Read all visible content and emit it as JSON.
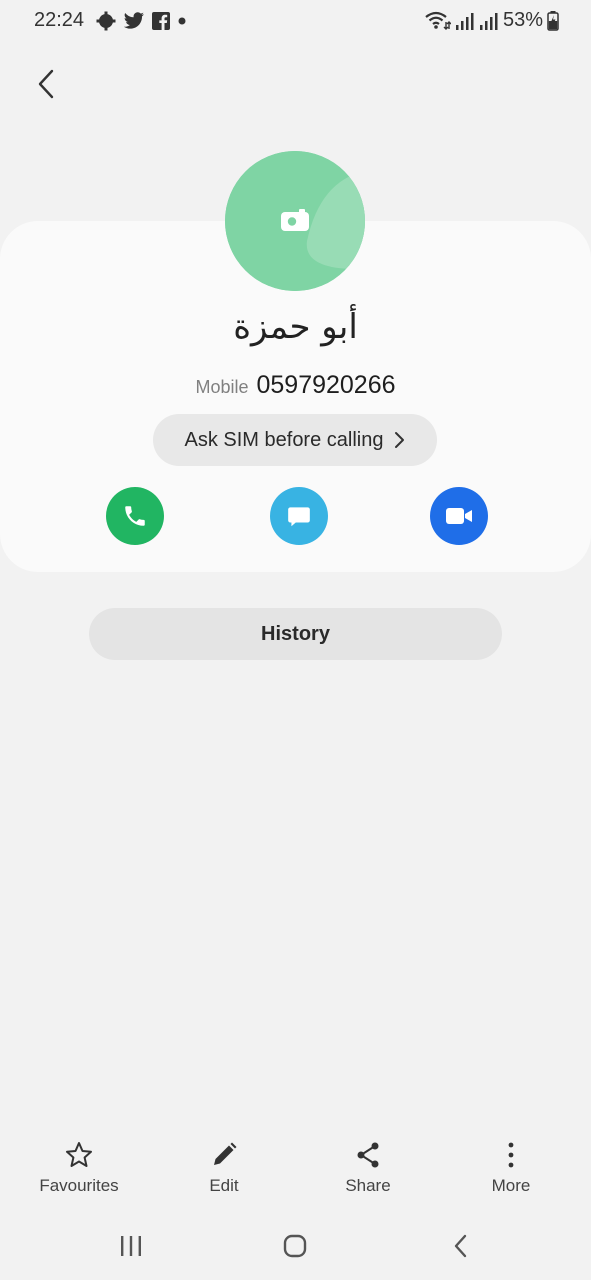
{
  "status_bar": {
    "time": "22:24",
    "battery": "53%",
    "left_icons": [
      "settings-gear-icon",
      "twitter-icon",
      "facebook-icon",
      "dot-icon"
    ],
    "right_icons": [
      "wifi-icon",
      "signal-1-icon",
      "signal-2-icon",
      "battery-charging-icon"
    ]
  },
  "contact": {
    "name": "أبو حمزة",
    "phone_type": "Mobile",
    "phone_number": "0597920266",
    "sim_option": "Ask SIM before calling",
    "avatar_color": "#7fd4a4"
  },
  "actions": {
    "call_icon": "phone-icon",
    "message_icon": "message-icon",
    "video_icon": "video-call-icon",
    "call_color": "#21b562",
    "message_color": "#38b3e3",
    "video_color": "#1f6ee8"
  },
  "history": {
    "label": "History"
  },
  "bottom_bar": {
    "favourites": "Favourites",
    "edit": "Edit",
    "share": "Share",
    "more": "More"
  },
  "nav_bar": {
    "icons": [
      "recents-icon",
      "home-icon",
      "back-icon"
    ]
  }
}
